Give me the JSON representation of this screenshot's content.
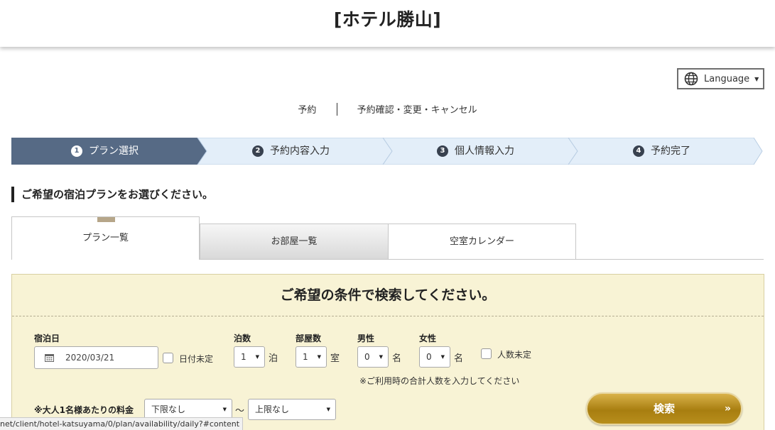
{
  "header": {
    "hotel_name": "[ホテル勝山]"
  },
  "language": {
    "label": "Language"
  },
  "top_links": {
    "reserve": "予約",
    "manage": "予約確認・変更・キャンセル"
  },
  "steps": [
    {
      "num": "1",
      "label": "プラン選択"
    },
    {
      "num": "2",
      "label": "予約内容入力"
    },
    {
      "num": "3",
      "label": "個人情報入力"
    },
    {
      "num": "4",
      "label": "予約完了"
    }
  ],
  "section_heading": "ご希望の宿泊プランをお選びください。",
  "tabs": {
    "plans": "プラン一覧",
    "rooms": "お部屋一覧",
    "calendar": "空室カレンダー"
  },
  "search": {
    "title": "ご希望の条件で検索してください。",
    "date_label": "宿泊日",
    "date_value": "2020/03/21",
    "date_undecided": "日付未定",
    "nights_label": "泊数",
    "nights_value": "1",
    "nights_unit": "泊",
    "rooms_label": "部屋数",
    "rooms_value": "1",
    "rooms_unit": "室",
    "male_label": "男性",
    "male_value": "0",
    "female_label": "女性",
    "female_value": "0",
    "person_unit": "名",
    "guests_undecided": "人数未定",
    "note": "※ご利用時の合計人数を入力してください",
    "price_label": "※大人1名様あたりの料金",
    "price_min": "下限なし",
    "price_tilde": "～",
    "price_max": "上限なし",
    "submit_label": "検索",
    "submit_chevron": "»"
  },
  "status_url": "net/client/hotel-katsuyama/0/plan/availability/daily?#content",
  "colors": {
    "step_active": "#566a85",
    "step_inactive": "#e3eef9",
    "panel_bg": "#f8f3d5",
    "button_gold": "#b8901e"
  }
}
